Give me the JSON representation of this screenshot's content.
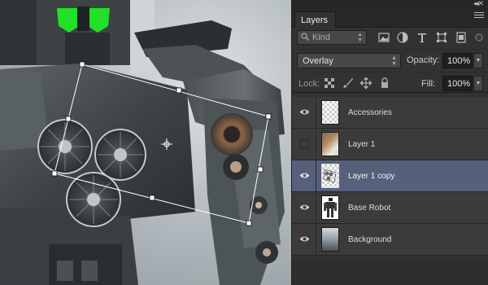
{
  "panel": {
    "tab_label": "Layers",
    "filter": {
      "kind_label": "Kind",
      "icons": [
        "image-filter-icon",
        "adjustment-filter-icon",
        "type-filter-icon",
        "shape-filter-icon",
        "smart-object-filter-icon"
      ]
    },
    "blend_mode": "Overlay",
    "opacity_label": "Opacity:",
    "opacity_value": "100%",
    "lock_label": "Lock:",
    "lock_icons": [
      "lock-transparent-icon",
      "lock-image-icon",
      "lock-position-icon",
      "lock-all-icon"
    ],
    "fill_label": "Fill:",
    "fill_value": "100%"
  },
  "layers": [
    {
      "name": "Accessories",
      "visible": true,
      "selected": false,
      "thumb": "checker"
    },
    {
      "name": "Layer 1",
      "visible": false,
      "selected": false,
      "thumb": "photo"
    },
    {
      "name": "Layer 1 copy",
      "visible": true,
      "selected": true,
      "thumb": "checker"
    },
    {
      "name": "Base Robot",
      "visible": true,
      "selected": false,
      "thumb": "robot"
    },
    {
      "name": "Background",
      "visible": true,
      "selected": false,
      "thumb": "bg"
    }
  ],
  "colors": {
    "selected_row": "#56607a",
    "panel_bg": "#323232",
    "visor_green": "#22e028"
  }
}
